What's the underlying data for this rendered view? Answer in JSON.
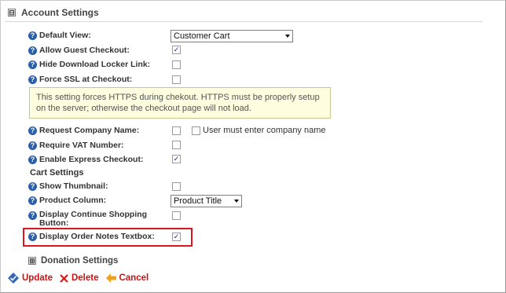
{
  "account_settings": {
    "title": "Account Settings",
    "toggle": "⊟"
  },
  "fields": {
    "default_view": {
      "label": "Default View:",
      "value": "Customer Cart"
    },
    "allow_guest_checkout": {
      "label": "Allow Guest Checkout:",
      "checked": true
    },
    "hide_download_locker": {
      "label": "Hide Download Locker Link:",
      "checked": false
    },
    "force_ssl": {
      "label": "Force SSL at Checkout:",
      "checked": false
    },
    "notice": "This setting forces HTTPS during chekout. HTTPS must be properly setup on the server; otherwise the checkout page will not load.",
    "request_company_name": {
      "label": "Request Company Name:",
      "checked": false,
      "extra_label": "User must enter company name",
      "extra_checked": false
    },
    "require_vat": {
      "label": "Require VAT Number:",
      "checked": false
    },
    "enable_express": {
      "label": "Enable Express Checkout:",
      "checked": true
    }
  },
  "cart_settings": {
    "title": "Cart Settings",
    "show_thumbnail": {
      "label": "Show Thumbnail:",
      "checked": false
    },
    "product_column": {
      "label": "Product Column:",
      "value": "Product Title"
    },
    "display_continue_shopping": {
      "label_line1": "Display Continue Shopping",
      "label_line2": "Button:",
      "checked": false
    },
    "display_order_notes": {
      "label": "Display Order Notes Textbox:",
      "checked": true
    }
  },
  "donation_settings": {
    "title": "Donation Settings",
    "toggle": "⊞"
  },
  "actions": {
    "update": "Update",
    "delete": "Delete",
    "cancel": "Cancel"
  },
  "colors": {
    "help_icon": "#2d5fa6",
    "action_text": "#cc1111",
    "highlight": "#e0141e",
    "notice_bg": "#fdfde0"
  }
}
